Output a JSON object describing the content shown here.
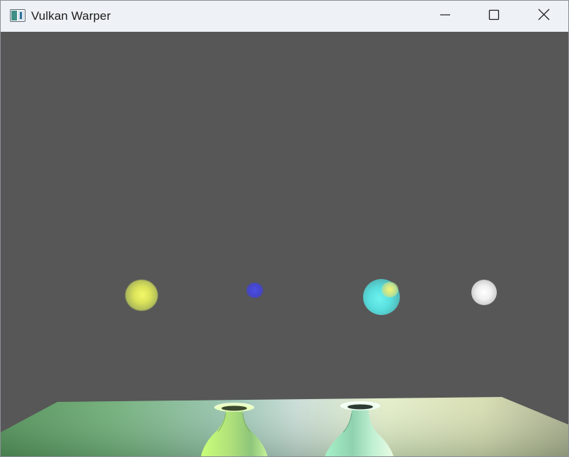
{
  "window": {
    "title": "Vulkan Warper",
    "icon": "app-window-icon",
    "controls": {
      "minimize_icon": "minimize-icon",
      "maximize_icon": "maximize-icon",
      "close_icon": "close-icon"
    }
  },
  "scene": {
    "background_color": "#575757",
    "lights": [
      {
        "name": "yellow-light",
        "color": "#e4eb5e"
      },
      {
        "name": "blue-light",
        "color": "#4646d0"
      },
      {
        "name": "cyan-light",
        "color": "#5fe3e1"
      },
      {
        "name": "white-light",
        "color": "#f2f2f2"
      }
    ],
    "objects": [
      {
        "name": "floor-plane",
        "color": "#7fb08a"
      },
      {
        "name": "vase-left",
        "color": "#b8f28a"
      },
      {
        "name": "vase-right",
        "color": "#9fe6c4"
      }
    ]
  }
}
